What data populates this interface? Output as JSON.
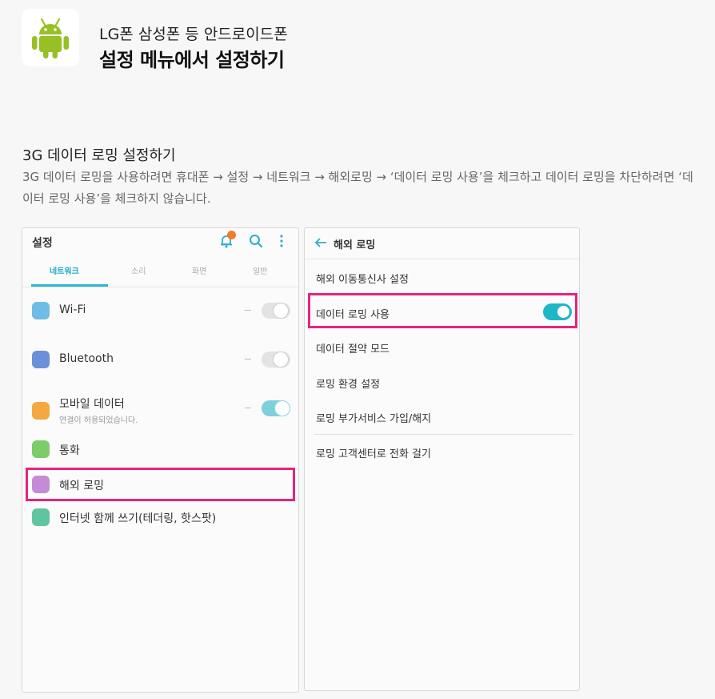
{
  "header": {
    "subtitle": "LG폰 삼성폰 등 안드로이드폰",
    "title": "설정 메뉴에서 설정하기"
  },
  "section": {
    "title": "3G 데이터 로밍 설정하기",
    "description": "3G 데이터 로밍을 사용하려면 휴대폰 → 설정 → 네트워크 → 해외로밍 → ‘데이터 로밍 사용’을 체크하고 데이터 로밍을 차단하려면 ‘데이터 로밍 사용’을 체크하지 않습니다."
  },
  "settings_screen": {
    "title": "설정",
    "icons": [
      "bell-icon",
      "search-icon",
      "more-icon"
    ],
    "tabs": [
      "네트워크",
      "소리",
      "화면",
      "일반"
    ],
    "active_tab": "네트워크",
    "items": [
      {
        "label": "Wi-Fi",
        "icon": "wifi-icon",
        "color": "#6fbde6",
        "toggle": "off"
      },
      {
        "label": "Bluetooth",
        "icon": "bluetooth-icon",
        "color": "#6b8fd8",
        "toggle": "off"
      },
      {
        "label": "모바일 데이터",
        "sub": "연결이 허용되었습니다.",
        "icon": "mobile-data-icon",
        "color": "#f3a940",
        "toggle": "on"
      },
      {
        "label": "통화",
        "icon": "phone-icon",
        "color": "#7ccc6a"
      },
      {
        "label": "해외 로밍",
        "icon": "roaming-icon",
        "color": "#c48bd6",
        "highlighted": true
      },
      {
        "label": "인터넷 함께 쓰기(테더링, 핫스팟)",
        "icon": "tethering-icon",
        "color": "#5fc5a0"
      }
    ],
    "highlight_color": "#e5247e"
  },
  "roaming_screen": {
    "title": "해외 로밍",
    "items": [
      "해외 이동통신사 설정",
      "데이터 로밍 사용",
      "데이터 절약 모드",
      "로밍 환경 설정",
      "로밍 부가서비스 가입/해지",
      "로밍 고객센터로 전화 걸기"
    ],
    "data_roaming_toggle": "on",
    "accent": "#1fb6c7"
  }
}
